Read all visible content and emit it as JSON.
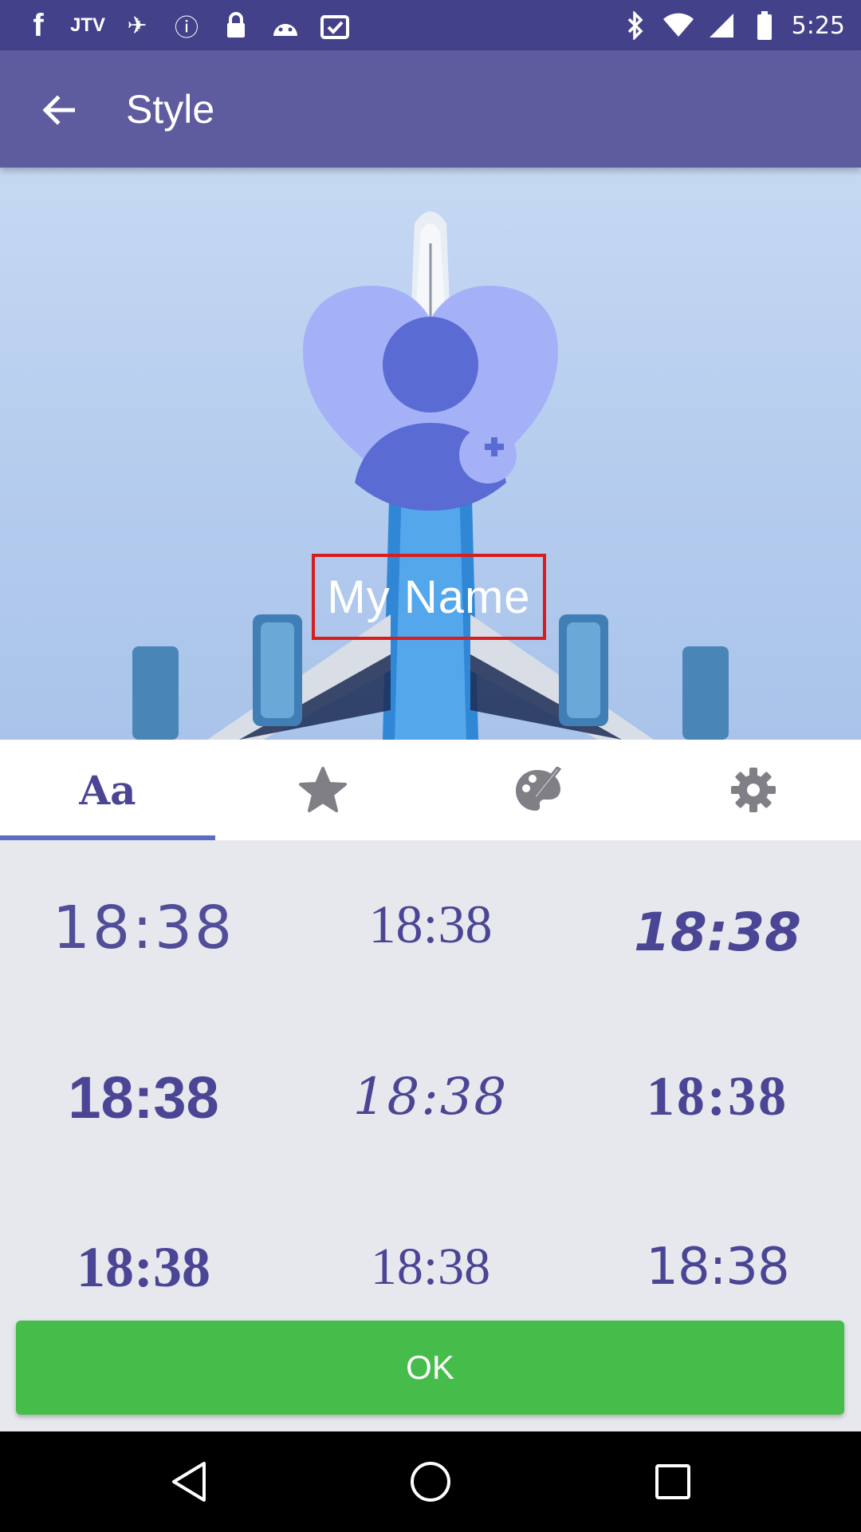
{
  "status_bar": {
    "time": "5:25",
    "left_icons": [
      "facebook-icon",
      "jio-tv-icon",
      "fake-gps-icon",
      "info-icon",
      "lock-icon",
      "android-icon",
      "clipboard-check-icon"
    ],
    "right_icons": [
      "bluetooth-icon",
      "wifi-icon",
      "signal-icon",
      "battery-icon"
    ]
  },
  "app_bar": {
    "title": "Style",
    "back_icon": "arrow-back-icon"
  },
  "preview": {
    "name_text": "My Name",
    "avatar_icon": "heart-add-person-icon"
  },
  "tabs": [
    {
      "label": "Aa",
      "icon": "font-icon",
      "active": true
    },
    {
      "label": "",
      "icon": "star-icon",
      "active": false
    },
    {
      "label": "",
      "icon": "palette-brush-icon",
      "active": false
    },
    {
      "label": "",
      "icon": "gear-icon",
      "active": false
    }
  ],
  "font_samples": [
    "18:38",
    "18:38",
    "18:38",
    "18:38",
    "18:38",
    "18:38",
    "18:38",
    "18:38",
    "18:38"
  ],
  "ok_label": "OK",
  "colors": {
    "status_bar": "#43418a",
    "app_bar": "#5f5b9f",
    "accent": "#5b6cc2",
    "font_color": "#4a4595",
    "ok_button": "#46bc4a",
    "heart": "#a5b1f7",
    "name_border": "#d91c1c"
  }
}
